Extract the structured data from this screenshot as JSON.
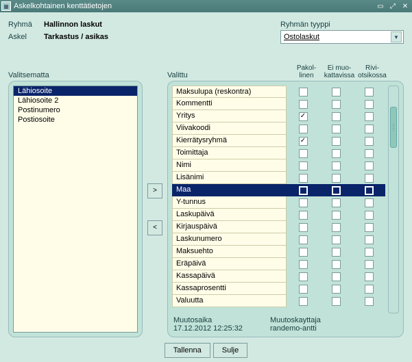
{
  "window": {
    "title": "Askelkohtainen kenttätietojen"
  },
  "labels": {
    "group": "Ryhmä",
    "group_value": "Hallinnon laskut",
    "step": "Askel",
    "step_value": "Tarkastus / asikas",
    "group_type": "Ryhmän tyyppi",
    "unselected": "Valitsematta",
    "selected": "Valittu",
    "required": "Pakol-\nlinen",
    "noedit": "Ei muo-\nkattavissa",
    "rowhead": "Rivi-\notsikossa",
    "time": "Muutosaika",
    "time_value": "17.12.2012 12:25:32",
    "user": "Muutoskayttaja",
    "user_value": "randemo-antti",
    "save": "Tallenna",
    "close": "Sulje"
  },
  "combo": {
    "value": "Ostolaskut"
  },
  "unselected": [
    {
      "label": "Lähiosoite",
      "selected": true
    },
    {
      "label": "Lähiosoite 2",
      "selected": false
    },
    {
      "label": "Postinumero",
      "selected": false
    },
    {
      "label": "Postiosoite",
      "selected": false
    }
  ],
  "selected_rows": [
    {
      "label": "Maksulupa (reskontra)",
      "req": false,
      "noedit": false,
      "row": false,
      "sel": false
    },
    {
      "label": "Kommentti",
      "req": false,
      "noedit": false,
      "row": false,
      "sel": false
    },
    {
      "label": "Yritys",
      "req": true,
      "noedit": false,
      "row": false,
      "sel": false
    },
    {
      "label": "Viivakoodi",
      "req": false,
      "noedit": false,
      "row": false,
      "sel": false
    },
    {
      "label": "Kierrätysryhmä",
      "req": true,
      "noedit": false,
      "row": false,
      "sel": false
    },
    {
      "label": "Toimittaja",
      "req": false,
      "noedit": false,
      "row": false,
      "sel": false
    },
    {
      "label": "Nimi",
      "req": false,
      "noedit": false,
      "row": false,
      "sel": false
    },
    {
      "label": "Lisänimi",
      "req": false,
      "noedit": false,
      "row": false,
      "sel": false
    },
    {
      "label": "Maa",
      "req": false,
      "noedit": false,
      "row": false,
      "sel": true
    },
    {
      "label": "Y-tunnus",
      "req": false,
      "noedit": false,
      "row": false,
      "sel": false
    },
    {
      "label": "Laskupäivä",
      "req": false,
      "noedit": false,
      "row": false,
      "sel": false
    },
    {
      "label": "Kirjauspäivä",
      "req": false,
      "noedit": false,
      "row": false,
      "sel": false
    },
    {
      "label": "Laskunumero",
      "req": false,
      "noedit": false,
      "row": false,
      "sel": false
    },
    {
      "label": "Maksuehto",
      "req": false,
      "noedit": false,
      "row": false,
      "sel": false
    },
    {
      "label": "Eräpäivä",
      "req": false,
      "noedit": false,
      "row": false,
      "sel": false
    },
    {
      "label": "Kassapäivä",
      "req": false,
      "noedit": false,
      "row": false,
      "sel": false
    },
    {
      "label": "Kassaprosentti",
      "req": false,
      "noedit": false,
      "row": false,
      "sel": false
    },
    {
      "label": "Valuutta",
      "req": false,
      "noedit": false,
      "row": false,
      "sel": false
    }
  ]
}
